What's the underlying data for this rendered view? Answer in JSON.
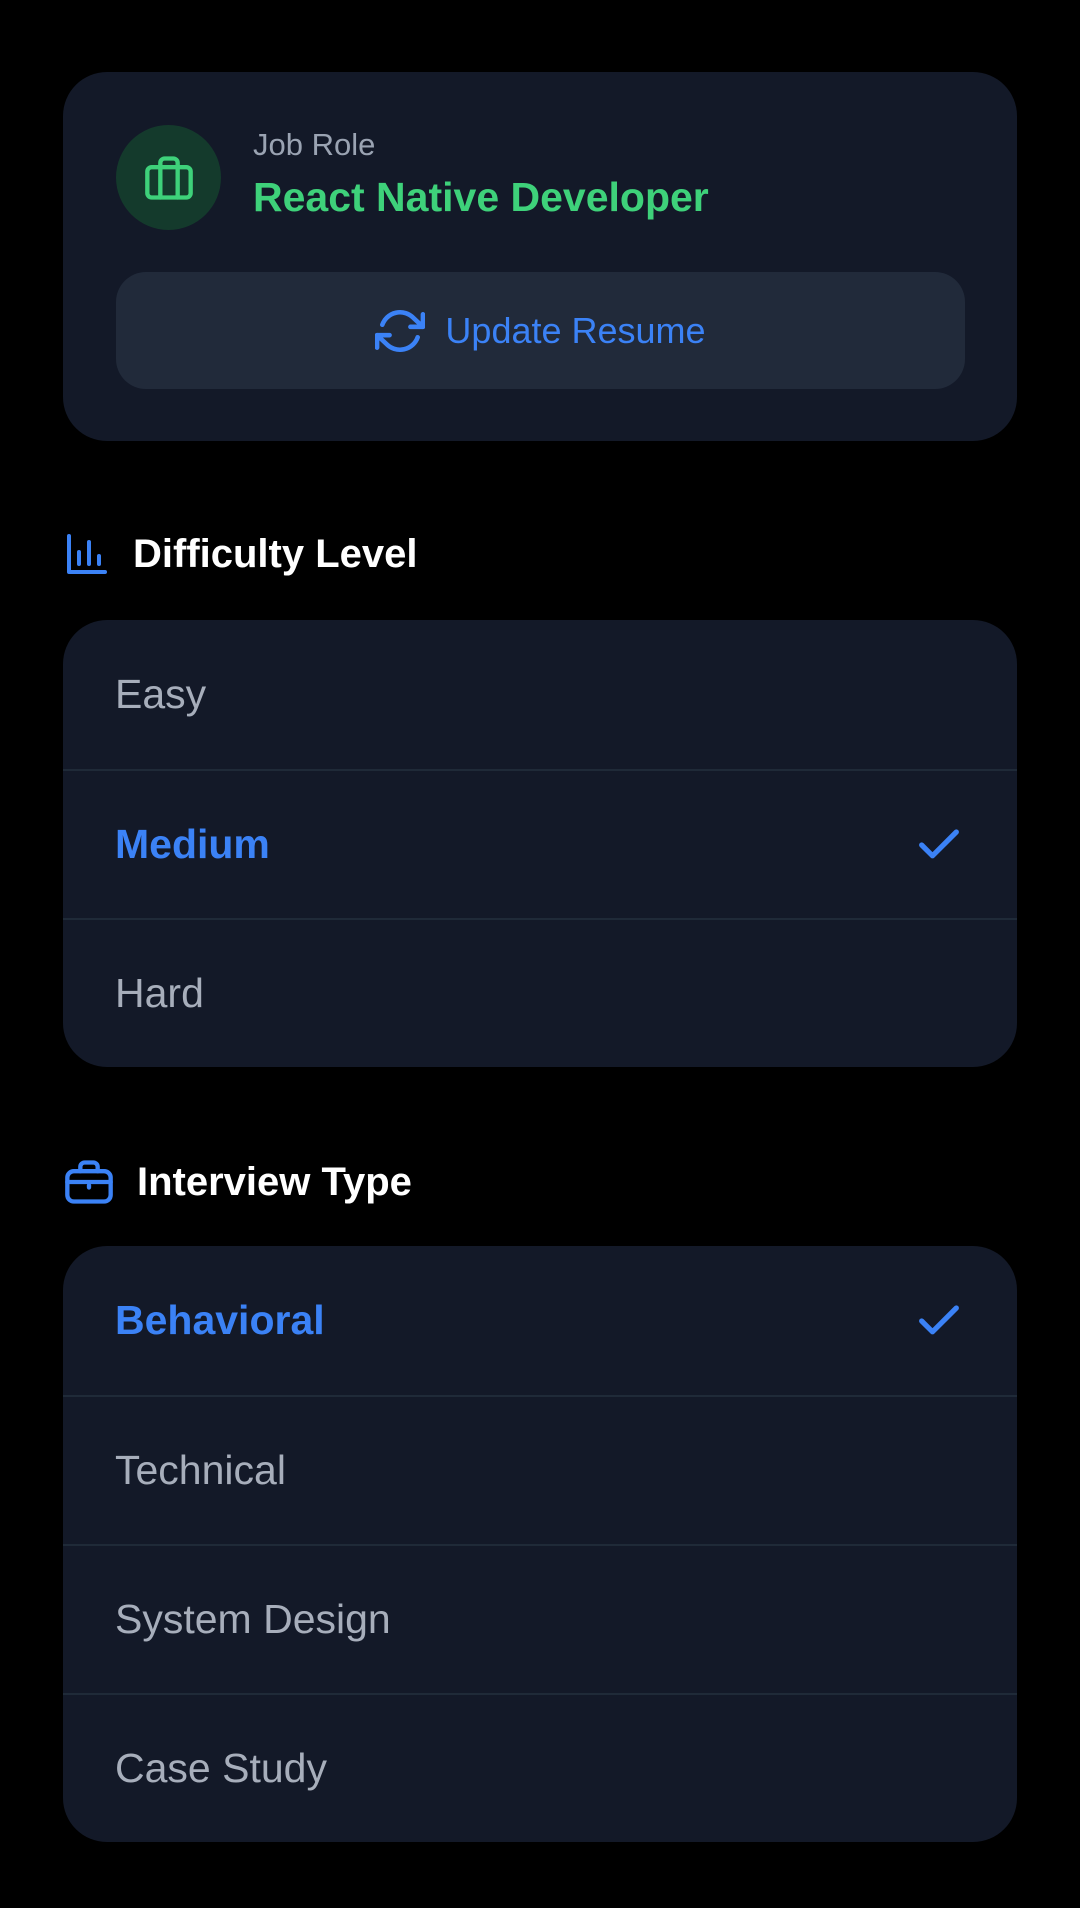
{
  "role_card": {
    "label": "Job Role",
    "value": "React Native Developer",
    "icon": "briefcase-icon",
    "update_button_label": "Update Resume",
    "update_button_icon": "refresh-icon"
  },
  "difficulty": {
    "title": "Difficulty Level",
    "icon": "bar-chart-icon",
    "options": [
      {
        "label": "Easy",
        "selected": false
      },
      {
        "label": "Medium",
        "selected": true
      },
      {
        "label": "Hard",
        "selected": false
      }
    ]
  },
  "interview_type": {
    "title": "Interview Type",
    "icon": "briefcase-icon",
    "options": [
      {
        "label": "Behavioral",
        "selected": true
      },
      {
        "label": "Technical",
        "selected": false
      },
      {
        "label": "System Design",
        "selected": false
      },
      {
        "label": "Case Study",
        "selected": false
      }
    ]
  },
  "colors": {
    "background": "#000000",
    "card": "#131928",
    "accent_blue": "#3b82f6",
    "accent_green": "#3ed17a",
    "text_muted": "#a7aebb"
  }
}
